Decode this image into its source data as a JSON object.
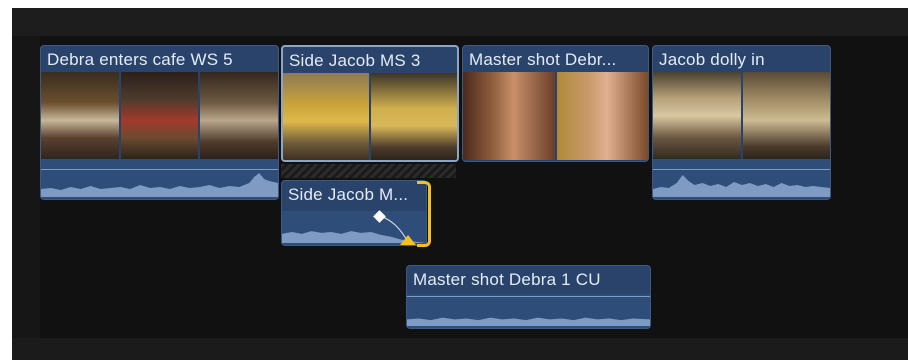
{
  "timeline": {
    "clips": [
      {
        "title": "Debra enters cafe WS 5"
      },
      {
        "title": "Side Jacob MS 3"
      },
      {
        "title": "Master shot Debr..."
      },
      {
        "title": "Jacob dolly in"
      },
      {
        "title": "Side Jacob M..."
      },
      {
        "title": "Master shot Debra 1 CU"
      }
    ]
  },
  "colors": {
    "clip_body": "#29436a",
    "audio": "#2f4d79",
    "selection": "#8ea6c6",
    "trim_handle": "#f2c21b"
  },
  "icons": {
    "keyframe": "diamond",
    "fade_handle": "triangle"
  }
}
